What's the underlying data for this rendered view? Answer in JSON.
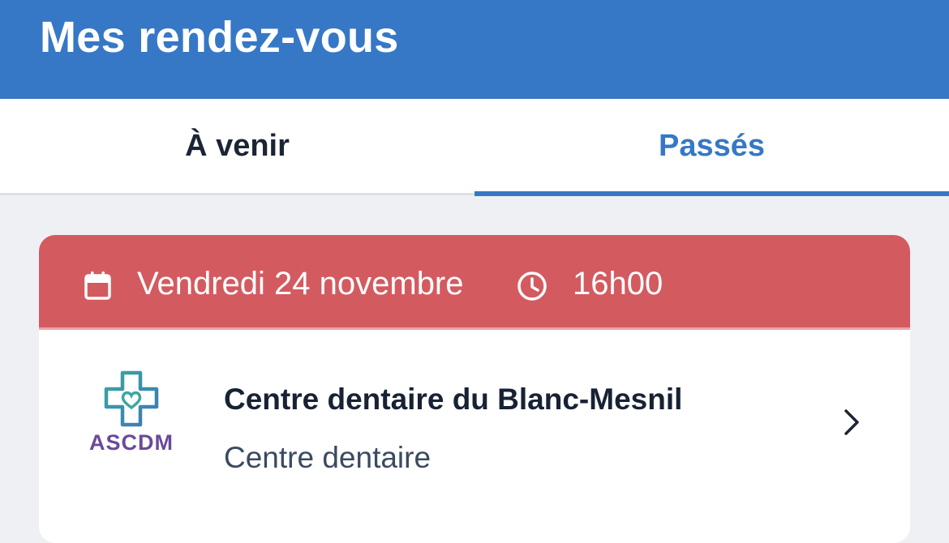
{
  "header": {
    "title": "Mes rendez-vous"
  },
  "tabs": [
    {
      "label": "À venir",
      "active": false
    },
    {
      "label": "Passés",
      "active": true
    }
  ],
  "appointment": {
    "date": "Vendredi 24 novembre",
    "time": "16h00",
    "center_name": "Centre dentaire du Blanc-Mesnil",
    "center_type": "Centre dentaire",
    "logo_text": "ASCDM",
    "status_color": "#d35b60"
  },
  "colors": {
    "primary": "#3678c6",
    "background": "#eef0f4",
    "card_header": "#d35b60"
  },
  "icons": {
    "date": "calendar-icon",
    "time": "clock-icon",
    "open": "chevron-right-icon"
  }
}
